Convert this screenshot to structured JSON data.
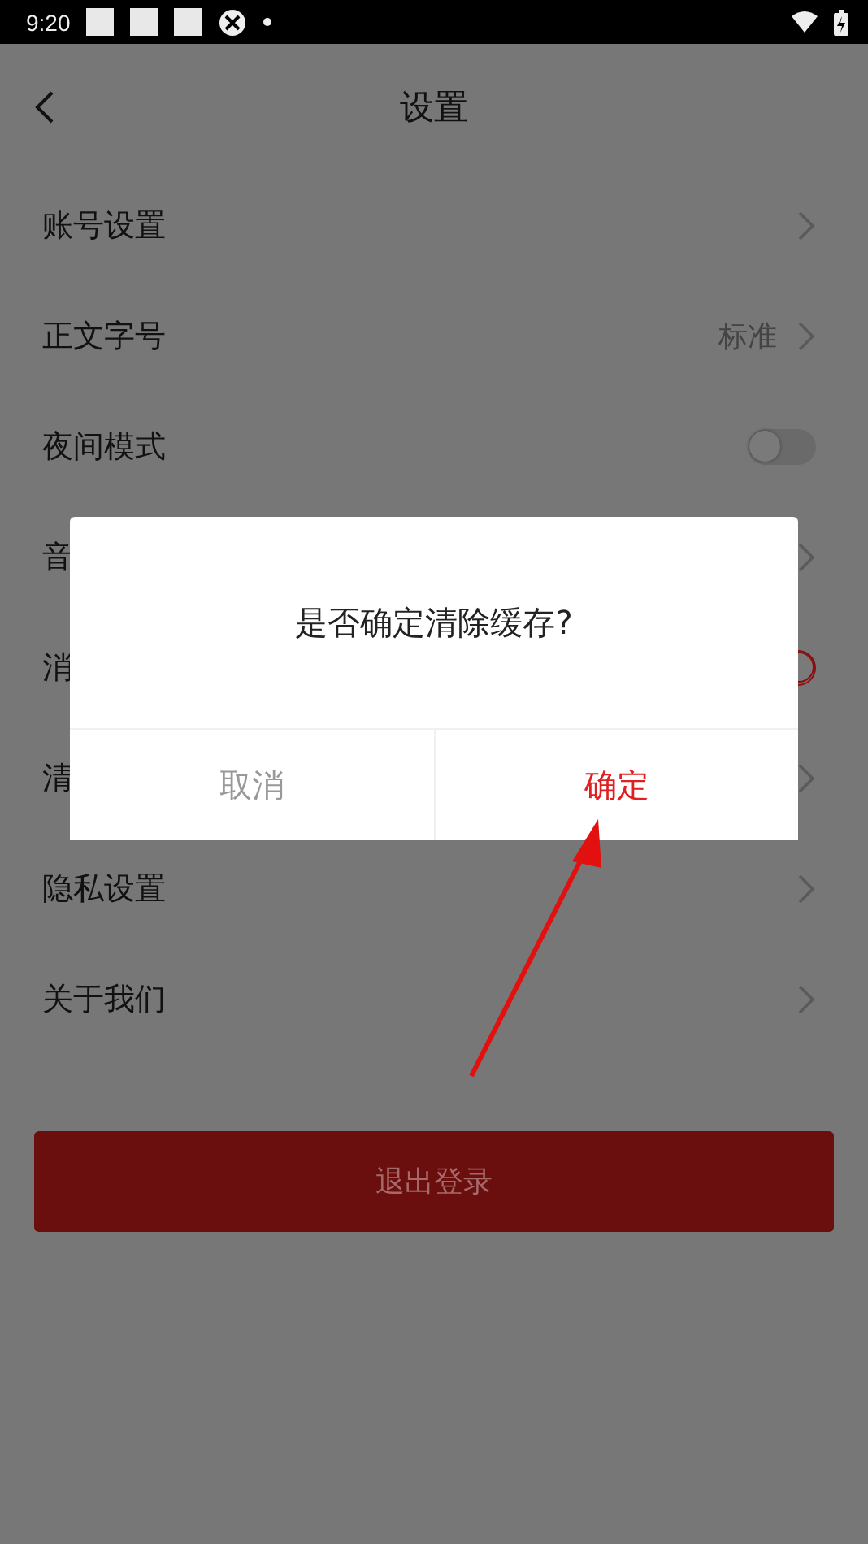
{
  "status_bar": {
    "time": "9:20"
  },
  "header": {
    "title": "设置"
  },
  "rows": [
    {
      "label": "账号设置",
      "kind": "chevron"
    },
    {
      "label": "正文字号",
      "kind": "chevron",
      "value": "标准"
    },
    {
      "label": "夜间模式",
      "kind": "toggle",
      "on": false
    },
    {
      "label": "音",
      "kind": "chevron"
    },
    {
      "label": "消",
      "kind": "toggle",
      "on": true
    },
    {
      "label": "清",
      "kind": "chevron"
    },
    {
      "label": "隐私设置",
      "kind": "chevron"
    },
    {
      "label": "关于我们",
      "kind": "chevron"
    }
  ],
  "logout_button": "退出登录",
  "dialog": {
    "message": "是否确定清除缓存?",
    "buttons": [
      {
        "label": "取消",
        "kind": "cancel"
      },
      {
        "label": "确定",
        "kind": "confirm"
      }
    ]
  }
}
